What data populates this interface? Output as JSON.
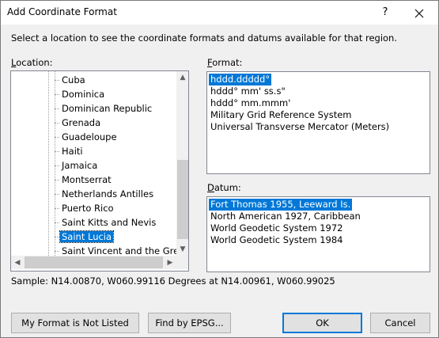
{
  "window": {
    "title": "Add Coordinate Format",
    "help_glyph": "?",
    "close_glyph": "✕"
  },
  "intro_text": "Select a location to see the coordinate formats and datums available for that region.",
  "location": {
    "label_key": "L",
    "label_rest": "ocation:",
    "items": [
      "Cuba",
      "Dominica",
      "Dominican Republic",
      "Grenada",
      "Guadeloupe",
      "Haiti",
      "Jamaica",
      "Montserrat",
      "Netherlands Antilles",
      "Puerto Rico",
      "Saint Kitts and Nevis",
      "Saint Lucia",
      "Saint Vincent and the Grena"
    ],
    "selected": "Saint Lucia",
    "scroll_up": "▲",
    "scroll_down": "▼",
    "scroll_left": "◀",
    "scroll_right": "▶"
  },
  "format": {
    "label_key": "F",
    "label_rest": "ormat:",
    "items": [
      "hddd.ddddd°",
      "hddd° mm' ss.s\"",
      "hddd° mm.mmm'",
      "Military Grid Reference System",
      "Universal Transverse Mercator (Meters)"
    ],
    "selected": "hddd.ddddd°"
  },
  "datum": {
    "label_key": "D",
    "label_rest": "atum:",
    "items": [
      "Fort Thomas 1955, Leeward Is.",
      "North American 1927, Caribbean",
      "World Geodetic System 1972",
      "World Geodetic System 1984"
    ],
    "selected": "Fort Thomas 1955, Leeward Is."
  },
  "sample_text": "Sample: N14.00870, W060.99116 Degrees at N14.00961, W060.99025",
  "buttons": {
    "not_listed": "My Format is Not Listed",
    "find_epsg": "Find by EPSG...",
    "ok": "OK",
    "cancel": "Cancel"
  },
  "colors": {
    "selection": "#0078d7",
    "dialog_bg": "#f0f0f0",
    "default_button_border": "#0078d7"
  }
}
